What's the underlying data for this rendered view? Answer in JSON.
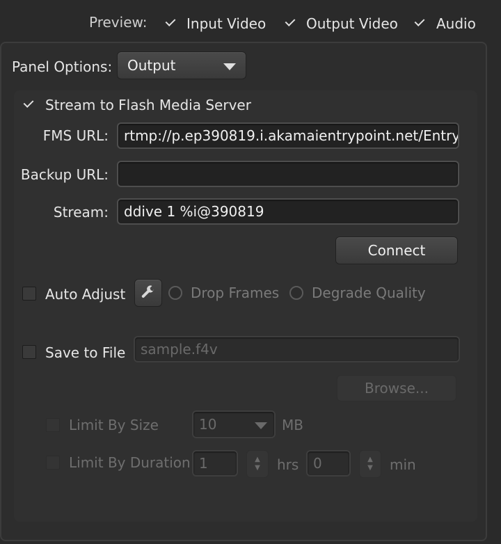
{
  "preview": {
    "label": "Preview:",
    "input_video": {
      "label": "Input Video",
      "checked": true
    },
    "output_video": {
      "label": "Output Video",
      "checked": true
    },
    "audio": {
      "label": "Audio",
      "checked": true
    }
  },
  "panel_options": {
    "label": "Panel Options:",
    "value": "Output"
  },
  "stream": {
    "checkbox_label": "Stream to Flash Media Server",
    "checked": true,
    "fms_url_label": "FMS URL:",
    "fms_url_value": "rtmp://p.ep390819.i.akamaientrypoint.net/Entry",
    "backup_url_label": "Backup URL:",
    "backup_url_value": "",
    "stream_label": "Stream:",
    "stream_value": "ddive  1  %i@390819",
    "connect_label": "Connect"
  },
  "auto_adjust": {
    "label": "Auto Adjust",
    "checked": false,
    "wrench_icon": "wrench-icon",
    "drop_frames_label": "Drop Frames",
    "degrade_quality_label": "Degrade Quality"
  },
  "save_to_file": {
    "label": "Save to File",
    "checked": false,
    "filename": "sample.f4v",
    "browse_label": "Browse..."
  },
  "limit_by_size": {
    "label": "Limit By Size",
    "value": "10",
    "unit": "MB"
  },
  "limit_by_duration": {
    "label": "Limit By Duration",
    "hours": "1",
    "hours_unit": "hrs",
    "minutes": "0",
    "minutes_unit": "min"
  }
}
